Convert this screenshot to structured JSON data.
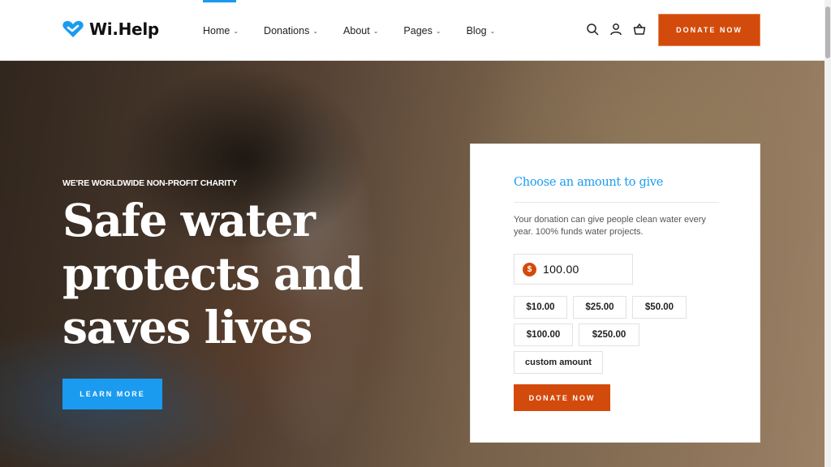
{
  "brand": {
    "name": "Wi.Help"
  },
  "nav": {
    "items": [
      {
        "label": "Home"
      },
      {
        "label": "Donations"
      },
      {
        "label": "About"
      },
      {
        "label": "Pages"
      },
      {
        "label": "Blog"
      }
    ],
    "donate_label": "DONATE NOW"
  },
  "hero": {
    "tagline": "WE'RE WORLDWIDE NON-PROFIT CHARITY",
    "headline": "Safe water protects and saves lives",
    "button_label": "LEARN MORE"
  },
  "donation_card": {
    "title": "Choose an amount to give",
    "description": "Your donation can give people clean water every year. 100% funds water projects.",
    "currency_symbol": "$",
    "amount": "100.00",
    "presets": [
      "$10.00",
      "$25.00",
      "$50.00",
      "$100.00",
      "$250.00"
    ],
    "custom_label": "custom amount",
    "donate_label": "DONATE NOW"
  },
  "colors": {
    "accent": "#1a9bf0",
    "brand_orange": "#d34b0c"
  }
}
